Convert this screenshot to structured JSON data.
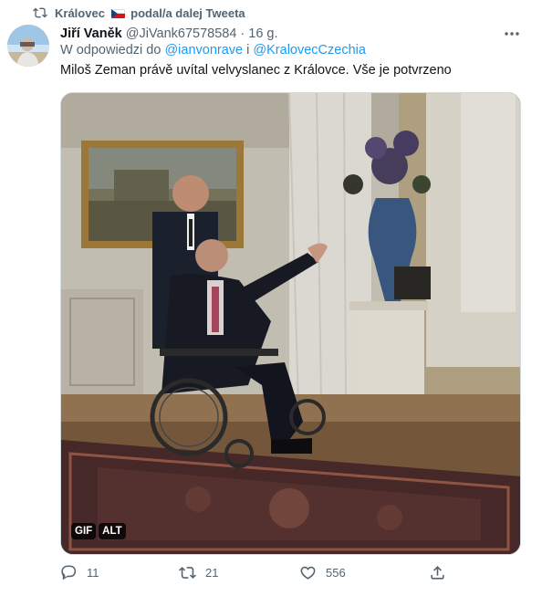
{
  "retweet": {
    "text_before_flag": "Královec",
    "text_after_flag": "podal/a dalej Tweeta",
    "icon": "retweet-icon"
  },
  "author": {
    "name": "Jiří Vaněk",
    "handle": "@JiVank67578584",
    "separator": "·",
    "time": "16 g."
  },
  "reply": {
    "prefix": "W odpowiedzi do",
    "mention_1": "@ianvonrave",
    "connector": "i",
    "mention_2": "@KralovecCzechia"
  },
  "tweet_text": "Miloš Zeman právě uvítal velvyslanec z Královce. Vše je potvrzeno",
  "media": {
    "gif_label": "GIF",
    "alt_label": "ALT"
  },
  "actions": {
    "reply_count": "11",
    "retweet_count": "21",
    "like_count": "556"
  },
  "colors": {
    "link": "#1d9bf0",
    "secondary_text": "#536471",
    "primary_text": "#0f1419",
    "border": "#cfd9de"
  }
}
